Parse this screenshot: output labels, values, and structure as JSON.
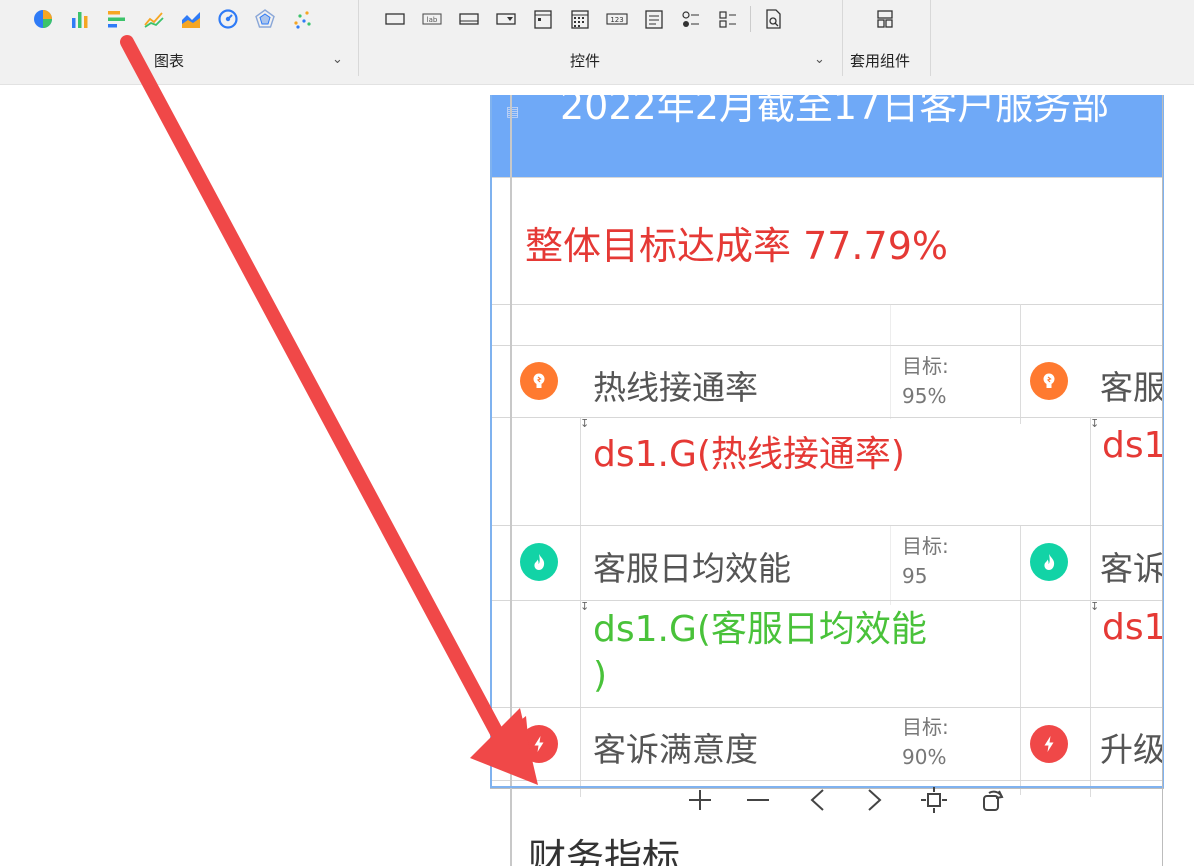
{
  "toolbar": {
    "groups": [
      {
        "label": "图表"
      },
      {
        "label": "控件"
      },
      {
        "label": "套用组件"
      }
    ],
    "chart_icons": [
      "pie-chart-icon",
      "bar-chart-icon",
      "horizontal-bar-chart-icon",
      "line-chart-icon",
      "area-chart-icon",
      "gauge-chart-icon",
      "radar-chart-icon",
      "scatter-chart-icon"
    ],
    "control_icons": [
      "button-control-icon",
      "label-control-icon",
      "text-box-control-icon",
      "dropdown-control-icon",
      "date-control-icon",
      "calendar-control-icon",
      "number-control-icon",
      "list-control-icon",
      "radio-group-control-icon",
      "checkbox-group-control-icon",
      "query-button-icon"
    ],
    "component_icons": [
      "layout-component-icon"
    ],
    "colors": {
      "accent_blue": "#2f7bf6",
      "orange": "#f6a623",
      "green": "#3cc36b",
      "red": "#e53935"
    }
  },
  "report": {
    "title": "2022年2月截至17日客户服务部",
    "overall_rate": "整体目标达成率 77.79%",
    "header_color": "#6fa9f7",
    "kpis_left": [
      {
        "name": "热线接通率",
        "target_label": "目标:",
        "target_value": "95%",
        "formula": "ds1.G(热线接通率)",
        "formula_color": "#e53935",
        "icon": "lightbulb-icon",
        "icon_color": "#ff7a30"
      },
      {
        "name": "客服日均效能",
        "target_label": "目标:",
        "target_value": "95",
        "formula_line1": "ds1.G(客服日均效能",
        "formula_line2": ")",
        "formula_color": "#49c23a",
        "icon": "flame-icon",
        "icon_color": "#12d3a6"
      },
      {
        "name": "客诉满意度",
        "target_label": "目标:",
        "target_value": "90%",
        "icon": "lightning-icon",
        "icon_color": "#f04848"
      }
    ],
    "kpis_right": [
      {
        "name": "客服",
        "formula": "ds1",
        "icon": "lightbulb-icon",
        "icon_color": "#ff7a30"
      },
      {
        "name": "客诉",
        "formula": "ds1",
        "icon": "flame-icon",
        "icon_color": "#12d3a6"
      },
      {
        "name": "升级",
        "icon": "lightning-icon",
        "icon_color": "#f04848"
      }
    ],
    "finance_title": "财务指标"
  },
  "canvas_controls": [
    "zoom-in-icon",
    "zoom-out-icon",
    "previous-icon",
    "next-icon",
    "fit-to-screen-icon",
    "rotate-icon"
  ]
}
